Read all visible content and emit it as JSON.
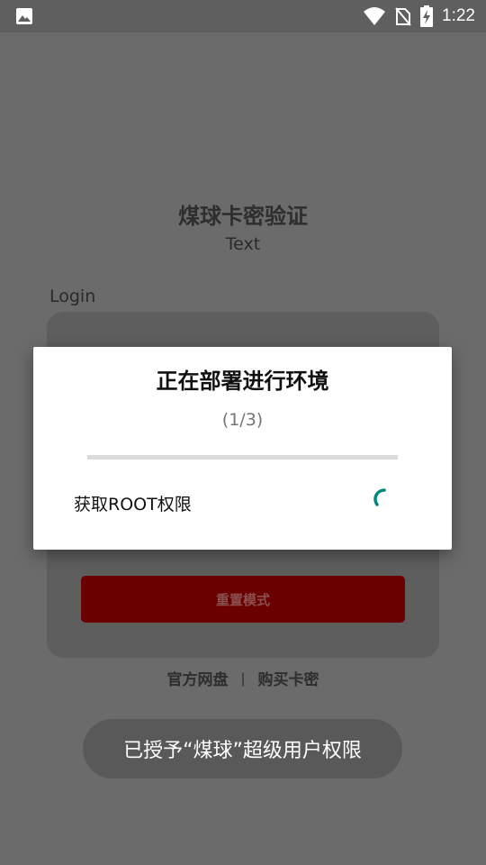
{
  "status_bar": {
    "time": "1:22",
    "icons": [
      "image-icon",
      "wifi-icon",
      "no-sim-icon",
      "battery-charging-icon"
    ]
  },
  "app": {
    "title": "煤球卡密验证",
    "subtitle": "Text",
    "login_label": "Login",
    "reset_button_label": "重置模式",
    "links": {
      "official_disk": "官方网盘",
      "separator": "|",
      "buy_card": "购买卡密"
    }
  },
  "dialog": {
    "title": "正在部署进行环境",
    "progress_text": "(1/3)",
    "progress_fraction": 0,
    "step_label": "获取ROOT权限",
    "spinner_icon": "loading-spinner-icon"
  },
  "toast": {
    "message": "已授予“煤球”超级用户权限"
  },
  "colors": {
    "scrim_background": "#6b6b6b",
    "dialog_background": "#ffffff",
    "accent": "#00897b",
    "reset_button": "#6a0000",
    "toast_background": "#595959"
  }
}
